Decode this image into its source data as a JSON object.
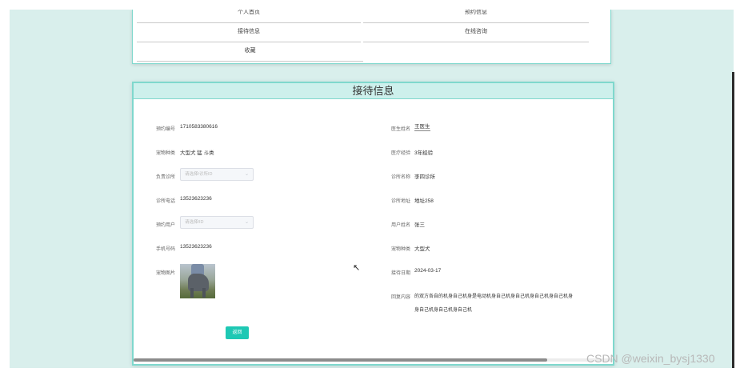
{
  "menu": {
    "items": [
      {
        "label": "个人首页"
      },
      {
        "label": "预约信息"
      },
      {
        "label": "接待信息"
      },
      {
        "label": "在线咨询"
      },
      {
        "label": "收藏"
      }
    ]
  },
  "card": {
    "title": "接待信息",
    "left_fields": [
      {
        "label": "预约编号",
        "value": "1710583380616"
      },
      {
        "label": "宠物种类",
        "value": "大型犬 猛 斗类"
      },
      {
        "label": "负责诊所",
        "placeholder": "请选择/诊所ID"
      },
      {
        "label": "诊所电话",
        "value": "13523623236"
      },
      {
        "label": "预约用户",
        "placeholder": "请选择/ID"
      },
      {
        "label": "手机号码",
        "value": "13523623236"
      },
      {
        "label": "宠物图片"
      }
    ],
    "right_fields": [
      {
        "label": "医生姓名",
        "value": "王医生"
      },
      {
        "label": "医疗经验",
        "value": "3年经验"
      },
      {
        "label": "诊所名称",
        "value": "李四诊所"
      },
      {
        "label": "诊所地址",
        "value": "地址258"
      },
      {
        "label": "用户姓名",
        "value": "张三"
      },
      {
        "label": "宠物种类",
        "value": "大型犬"
      },
      {
        "label": "接待日期",
        "value": "2024-03-17"
      },
      {
        "label": "回复内容",
        "value": "的双方各自的机身自己机身是电动机身自己机身自己机身自己机身自己机身",
        "value2": "身自己机身自己机身自己机"
      }
    ],
    "back_label": "返回"
  },
  "watermark": "CSDN @weixin_bysj1330",
  "colors": {
    "accent": "#1ec8b4",
    "border": "#7fd8cd",
    "header_bg": "#cdf0ec",
    "page_bg": "#d9efec"
  }
}
